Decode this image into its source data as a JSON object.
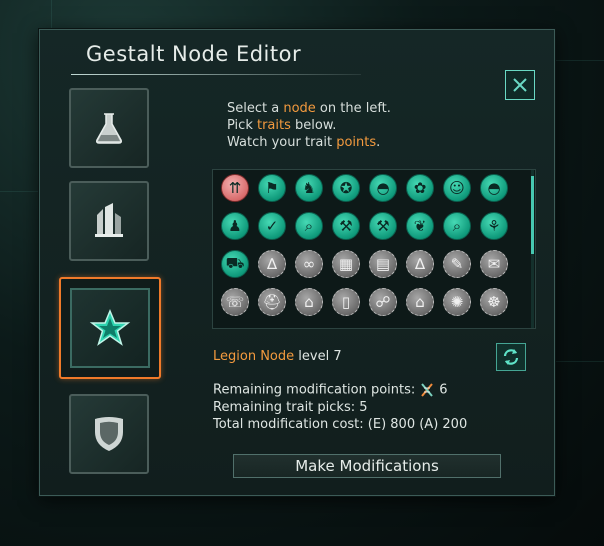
{
  "window": {
    "title": "Gestalt Node Editor",
    "close_icon": "close-icon"
  },
  "instructions": {
    "line1_a": "Select a ",
    "line1_b": "node",
    "line1_c": " on the left.",
    "line2_a": "Pick ",
    "line2_b": "traits",
    "line2_c": " below.",
    "line3_a": "Watch your trait ",
    "line3_b": "points",
    "line3_c": "."
  },
  "nodes": [
    {
      "icon": "flask-icon",
      "selected": false
    },
    {
      "icon": "building-icon",
      "selected": false
    },
    {
      "icon": "star-icon",
      "selected": true
    },
    {
      "icon": "shield-icon",
      "selected": false
    }
  ],
  "traits": [
    {
      "icon": "upgrade-arrows-icon",
      "state": "red"
    },
    {
      "icon": "runner-icon",
      "state": "green"
    },
    {
      "icon": "bird-icon",
      "state": "green"
    },
    {
      "icon": "medal-icon",
      "state": "green"
    },
    {
      "icon": "cap-icon",
      "state": "green"
    },
    {
      "icon": "ribbon-icon",
      "state": "green"
    },
    {
      "icon": "head-icon",
      "state": "green"
    },
    {
      "icon": "cap-icon",
      "state": "green"
    },
    {
      "icon": "crowd-icon",
      "state": "green"
    },
    {
      "icon": "thumbs-up-icon",
      "state": "green"
    },
    {
      "icon": "magnifier-icon",
      "state": "green"
    },
    {
      "icon": "anvil-icon",
      "state": "green"
    },
    {
      "icon": "hammers-icon",
      "state": "green"
    },
    {
      "icon": "leaf-icon",
      "state": "green"
    },
    {
      "icon": "magnifier-icon",
      "state": "green"
    },
    {
      "icon": "wheat-icon",
      "state": "green"
    },
    {
      "icon": "cart-icon",
      "state": "green"
    },
    {
      "icon": "compass-icon",
      "state": "grey"
    },
    {
      "icon": "glasses-icon",
      "state": "grey"
    },
    {
      "icon": "grid-icon",
      "state": "grey"
    },
    {
      "icon": "book-icon",
      "state": "grey"
    },
    {
      "icon": "compass-icon",
      "state": "grey"
    },
    {
      "icon": "pen-icon",
      "state": "grey"
    },
    {
      "icon": "speech-icon",
      "state": "grey"
    },
    {
      "icon": "phone-icon",
      "state": "grey"
    },
    {
      "icon": "helmet-icon",
      "state": "grey"
    },
    {
      "icon": "graduation-icon",
      "state": "grey"
    },
    {
      "icon": "device-icon",
      "state": "grey"
    },
    {
      "icon": "group-icon",
      "state": "grey"
    },
    {
      "icon": "house-icon",
      "state": "grey"
    },
    {
      "icon": "bulb-icon",
      "state": "grey"
    },
    {
      "icon": "handshake-icon",
      "state": "grey"
    }
  ],
  "node_info": {
    "name": "Legion Node",
    "level_text": " level 7"
  },
  "refresh_icon": "refresh-icon",
  "stats": {
    "points_label": "Remaining modification points:",
    "points_value": "6",
    "picks": "Remaining trait picks: 5",
    "cost": "Total modification cost: (E) 800 (A) 200"
  },
  "make_button": "Make Modifications",
  "colors": {
    "accent_orange": "#f07a2a",
    "accent_teal": "#47c8b1",
    "trait_green": "#0f9a7b",
    "trait_red": "#d86c6c",
    "trait_grey": "#6b6b6b"
  }
}
